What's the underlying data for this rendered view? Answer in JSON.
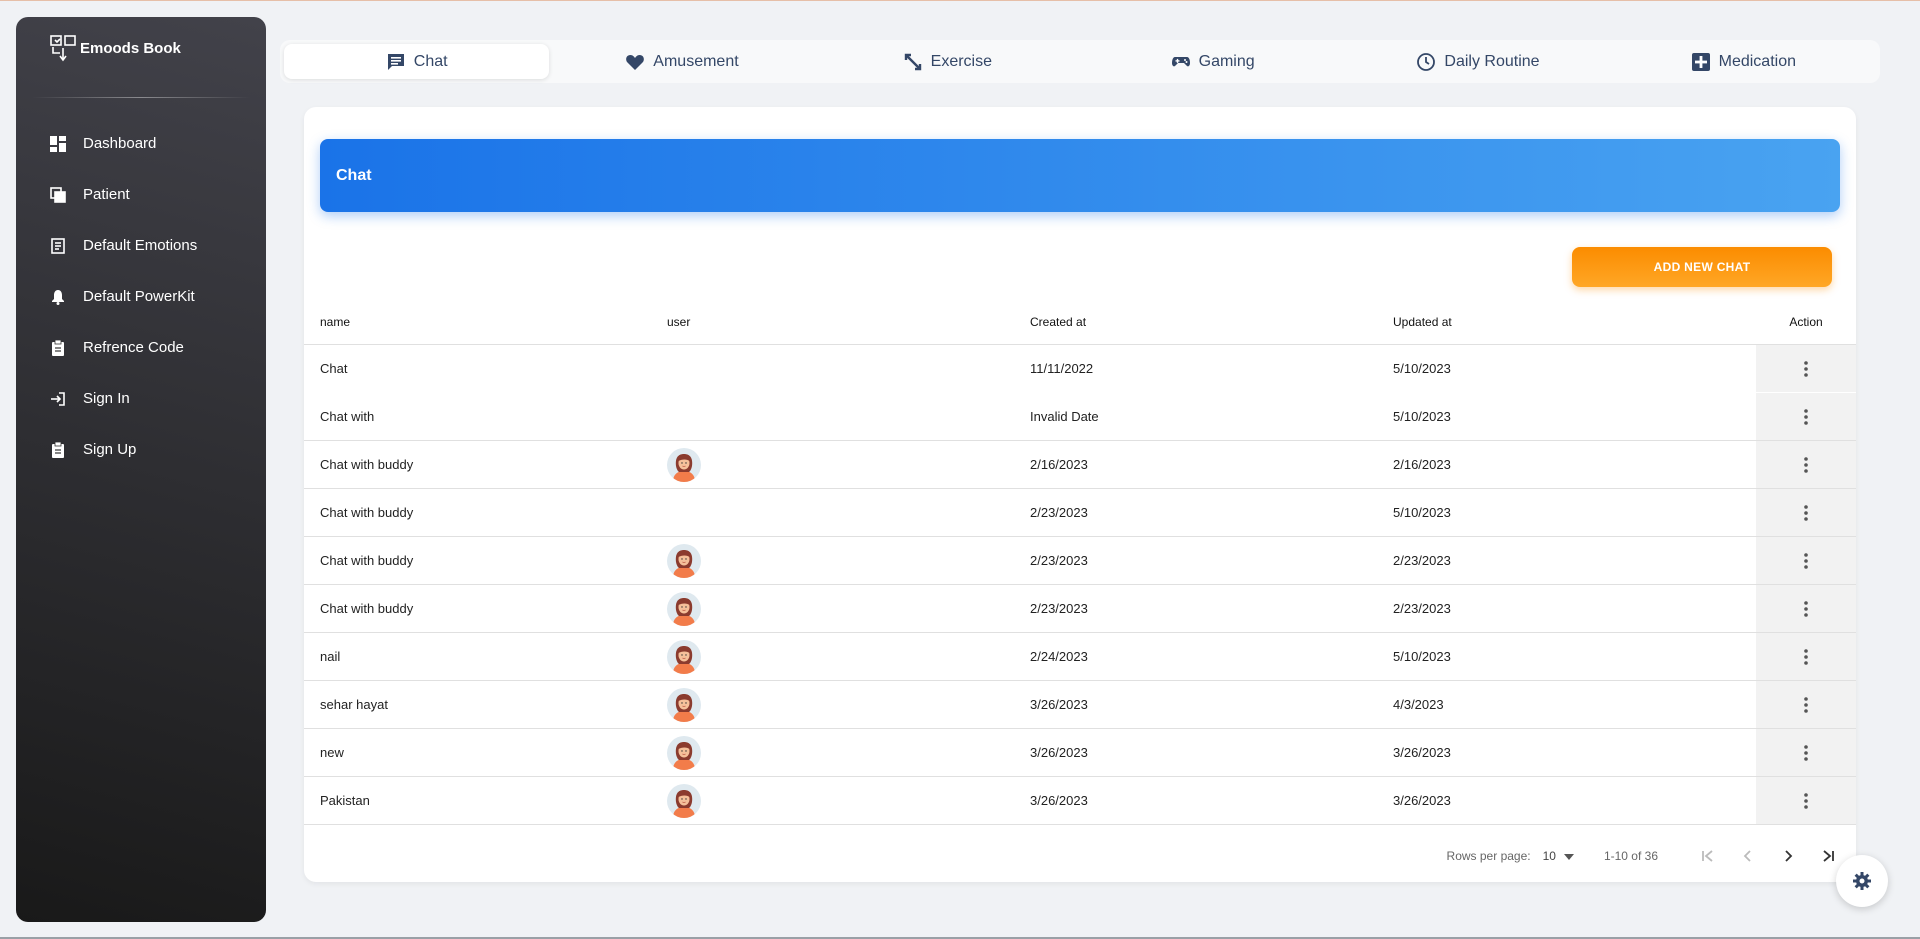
{
  "sidebar": {
    "brand": "Emoods Book",
    "items": [
      {
        "label": "Dashboard",
        "icon": "dashboard-icon"
      },
      {
        "label": "Patient",
        "icon": "copy-icon"
      },
      {
        "label": "Default Emotions",
        "icon": "receipt-icon"
      },
      {
        "label": "Default PowerKit",
        "icon": "bell-icon"
      },
      {
        "label": "Refrence Code",
        "icon": "clipboard-icon"
      },
      {
        "label": "Sign In",
        "icon": "login-icon"
      },
      {
        "label": "Sign Up",
        "icon": "clipboard-icon"
      }
    ]
  },
  "tabs": [
    {
      "label": "Chat",
      "icon": "chat-icon",
      "active": true
    },
    {
      "label": "Amusement",
      "icon": "heart-icon"
    },
    {
      "label": "Exercise",
      "icon": "expand-icon"
    },
    {
      "label": "Gaming",
      "icon": "gamepad-icon"
    },
    {
      "label": "Daily Routine",
      "icon": "clock-icon"
    },
    {
      "label": "Medication",
      "icon": "plus-box-icon"
    }
  ],
  "card": {
    "title": "Chat",
    "add_button": "ADD NEW CHAT"
  },
  "table": {
    "headers": {
      "name": "name",
      "user": "user",
      "created": "Created at",
      "updated": "Updated at",
      "action": "Action"
    },
    "rows": [
      {
        "name": "Chat",
        "avatar": false,
        "created": "11/11/2022",
        "updated": "5/10/2023"
      },
      {
        "name": "Chat with",
        "avatar": false,
        "created": "Invalid Date",
        "updated": "5/10/2023"
      },
      {
        "name": "Chat with buddy",
        "avatar": true,
        "created": "2/16/2023",
        "updated": "2/16/2023"
      },
      {
        "name": "Chat with buddy",
        "avatar": false,
        "created": "2/23/2023",
        "updated": "5/10/2023"
      },
      {
        "name": "Chat with buddy",
        "avatar": true,
        "created": "2/23/2023",
        "updated": "2/23/2023"
      },
      {
        "name": "Chat with buddy",
        "avatar": true,
        "created": "2/23/2023",
        "updated": "2/23/2023"
      },
      {
        "name": "nail",
        "avatar": true,
        "created": "2/24/2023",
        "updated": "5/10/2023"
      },
      {
        "name": "sehar hayat",
        "avatar": true,
        "created": "3/26/2023",
        "updated": "4/3/2023"
      },
      {
        "name": "new",
        "avatar": true,
        "created": "3/26/2023",
        "updated": "3/26/2023"
      },
      {
        "name": "Pakistan",
        "avatar": true,
        "created": "3/26/2023",
        "updated": "3/26/2023"
      }
    ]
  },
  "pagination": {
    "rows_per_page_label": "Rows per page:",
    "rows_per_page": "10",
    "range": "1-10 of 36"
  },
  "colors": {
    "accent_blue": "#1a73e8",
    "accent_orange": "#fb8c00",
    "sidebar_dark": "#191919"
  }
}
